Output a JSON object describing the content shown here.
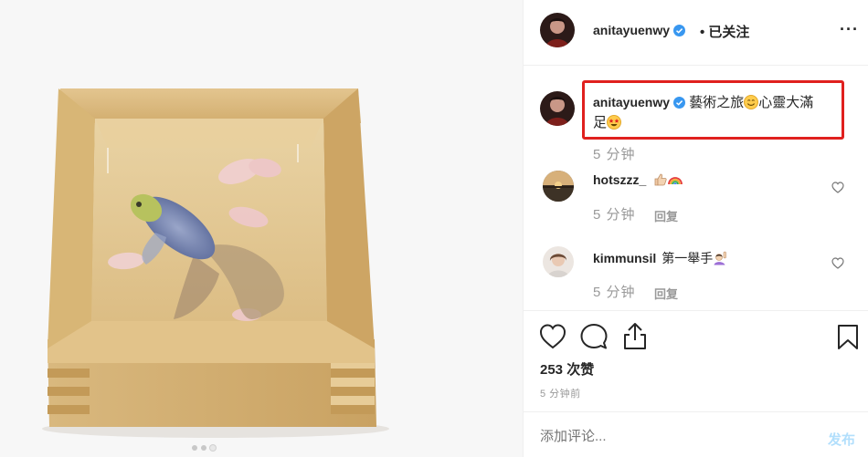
{
  "media": {
    "alt": "resin goldfish painting in wooden masu box",
    "carousel_dots": 3,
    "active_dot": 2
  },
  "post_header": {
    "username": "anitayuenwy",
    "verified_icon": "verified-badge-icon",
    "follow_state": "• 已关注",
    "more_label": "···"
  },
  "caption": {
    "username": "anitayuenwy",
    "text_part1": "藝術之旅",
    "emoji1": "smiling-face-emoji",
    "text_part2": "心靈大滿",
    "text_part3": "足",
    "emoji2": "star-struck-emoji",
    "time": "5 分钟"
  },
  "comments": [
    {
      "username": "hotszzz_",
      "text": "",
      "emojis": [
        "thumbs-up-emoji",
        "rainbow-emoji"
      ],
      "time": "5 分钟",
      "reply_label": "回复"
    },
    {
      "username": "kimmunsil",
      "text": "第一舉手",
      "emojis": [
        "person-raising-hand-emoji"
      ],
      "time": "5 分钟",
      "reply_label": "回复"
    }
  ],
  "actions": {
    "like_icon": "heart-icon",
    "comment_icon": "comment-bubble-icon",
    "share_icon": "share-icon",
    "save_icon": "bookmark-icon"
  },
  "likes": "253 次赞",
  "post_time": "5 分钟前",
  "add_comment": {
    "placeholder": "添加评论...",
    "publish_label": "发布"
  },
  "colors": {
    "highlight": "#e0201e",
    "verified": "#3897f0",
    "muted": "#999999",
    "publish_disabled": "#b2dffc"
  }
}
